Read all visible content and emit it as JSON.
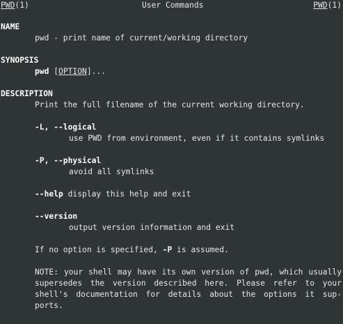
{
  "header": {
    "left_name": "PWD",
    "left_section": "(1)",
    "center_title": "User Commands",
    "right_name": "PWD",
    "right_section": "(1)"
  },
  "name_section": {
    "heading": "NAME",
    "text": "pwd - print name of current/working directory"
  },
  "synopsis_section": {
    "heading": "SYNOPSIS",
    "command": "pwd",
    "open_bracket": " [",
    "option": "OPTION",
    "close": "]..."
  },
  "description_section": {
    "heading": "DESCRIPTION",
    "intro": "Print the full filename of the current working directory.",
    "options": [
      {
        "flag": "-L, --logical",
        "desc": "use PWD from environment, even if it contains symlinks"
      },
      {
        "flag": "-P, --physical",
        "desc": "avoid all symlinks"
      },
      {
        "flag": "--help",
        "desc": " display this help and exit"
      },
      {
        "flag": "--version",
        "desc": "output version information and exit"
      }
    ],
    "default_note_pre": "If no option is specified, ",
    "default_note_flag": "-P",
    "default_note_post": " is assumed.",
    "note_lines": [
      "NOTE: your shell may have its own version of pwd, which usually",
      "supersedes the version described here. Please refer to your",
      "shell's documentation for details about the options it sup-",
      "ports."
    ]
  }
}
